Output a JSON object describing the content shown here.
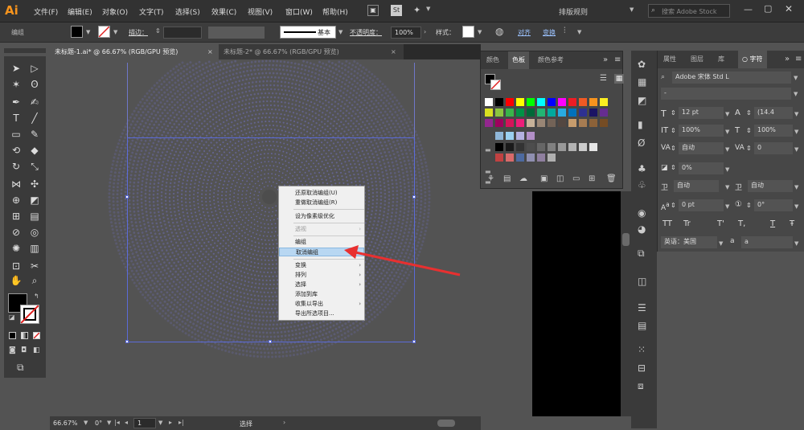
{
  "app": {
    "logo": "Ai"
  },
  "menubar": {
    "items": [
      "文件(F)",
      "编辑(E)",
      "对象(O)",
      "文字(T)",
      "选择(S)",
      "效果(C)",
      "视图(V)",
      "窗口(W)",
      "帮助(H)"
    ],
    "workspace": "排版规则",
    "search_placeholder": "搜索 Adobe Stock"
  },
  "controlbar": {
    "group_label": "编组",
    "stroke_label": "描边：",
    "stroke_style": "基本",
    "opacity_label": "不透明度：",
    "opacity_value": "100%",
    "style_label": "样式：",
    "align_label": "对齐",
    "transform_label": "变换"
  },
  "tabs": [
    {
      "label": "未标题-1.ai* @ 66.67% (RGB/GPU 预览)",
      "close": "×"
    },
    {
      "label": "未标题-2* @ 66.67% (RGB/GPU 预览)",
      "close": "×"
    }
  ],
  "context_menu": {
    "items": [
      {
        "label": "还原取消编组(U)",
        "enabled": true
      },
      {
        "label": "重做取消编组(R)",
        "enabled": true
      },
      {
        "label": "设为像素级优化",
        "enabled": true
      },
      {
        "label": "透视",
        "enabled": false
      },
      {
        "label": "编组",
        "enabled": true
      },
      {
        "label": "取消编组",
        "enabled": true,
        "highlighted": true
      },
      {
        "label": "变换",
        "enabled": true
      },
      {
        "label": "排列",
        "enabled": true
      },
      {
        "label": "选择",
        "enabled": true
      },
      {
        "label": "添加到库",
        "enabled": true
      },
      {
        "label": "收集以导出",
        "enabled": true
      },
      {
        "label": "导出所选项目...",
        "enabled": true
      }
    ]
  },
  "swatches_panel": {
    "tabs": [
      "颜色",
      "色板",
      "颜色参考"
    ],
    "active_tab": "色板"
  },
  "character_panel": {
    "tabs": [
      "属性",
      "图层",
      "库",
      "字符"
    ],
    "active_tab": "字符",
    "font": "Adobe 宋体 Std L",
    "font_size": "12 pt",
    "leading": "(14.4",
    "vscale": "100%",
    "hscale": "100%",
    "kerning": "自动",
    "tracking": "0",
    "tsume": "0%",
    "aki_left": "自动",
    "aki_right": "自动",
    "baseline": "0 pt",
    "rotation": "0°",
    "language": "英语：美国",
    "tt_buttons": [
      "TT",
      "Tr",
      "T'",
      "T,",
      "T",
      "Ŧ"
    ],
    "a_label": "a",
    "a_value": "a"
  },
  "statusbar": {
    "zoom": "66.67%",
    "rotation": "0°",
    "artboard": "1",
    "tool": "选择"
  },
  "colors": {
    "arrow": "#e83030",
    "dots": "#6f6fb8",
    "highlight": "#b8d7f2"
  }
}
